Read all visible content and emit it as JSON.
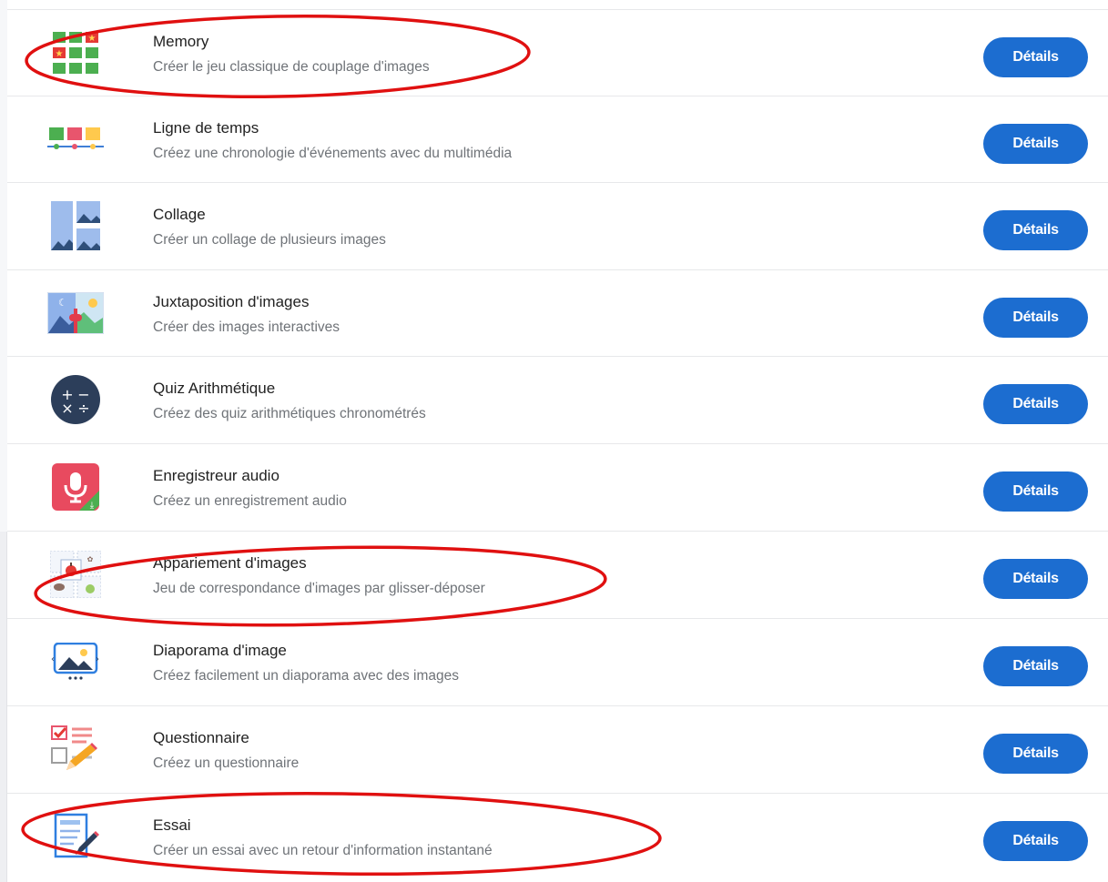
{
  "colors": {
    "button": "#1c6dd0",
    "annotation": "#e01010"
  },
  "items": [
    {
      "title": "Memory",
      "description": "Créer le jeu classique de couplage d'images",
      "button": "Détails",
      "icon": "memory-grid-icon",
      "highlighted": true
    },
    {
      "title": "Ligne de temps",
      "description": "Créez une chronologie d'événements avec du multimédia",
      "button": "Détails",
      "icon": "timeline-icon",
      "highlighted": false
    },
    {
      "title": "Collage",
      "description": "Créer un collage de plusieurs images",
      "button": "Détails",
      "icon": "collage-icon",
      "highlighted": false
    },
    {
      "title": "Juxtaposition d'images",
      "description": "Créer des images interactives",
      "button": "Détails",
      "icon": "image-juxtaposition-icon",
      "highlighted": false
    },
    {
      "title": "Quiz Arithmétique",
      "description": "Créez des quiz arithmétiques chronométrés",
      "button": "Détails",
      "icon": "arithmetic-quiz-icon",
      "highlighted": false
    },
    {
      "title": "Enregistreur audio",
      "description": "Créez un enregistrement audio",
      "button": "Détails",
      "icon": "microphone-icon",
      "highlighted": false
    },
    {
      "title": "Appariement d'images",
      "description": "Jeu de correspondance d'images par glisser-déposer",
      "button": "Détails",
      "icon": "image-pairing-icon",
      "highlighted": true
    },
    {
      "title": "Diaporama d'image",
      "description": "Créez facilement un diaporama avec des images",
      "button": "Détails",
      "icon": "slideshow-icon",
      "highlighted": false
    },
    {
      "title": "Questionnaire",
      "description": "Créez un questionnaire",
      "button": "Détails",
      "icon": "questionnaire-icon",
      "highlighted": false
    },
    {
      "title": "Essai",
      "description": "Créer un essai avec un retour d'information instantané",
      "button": "Détails",
      "icon": "essay-icon",
      "highlighted": true
    }
  ]
}
